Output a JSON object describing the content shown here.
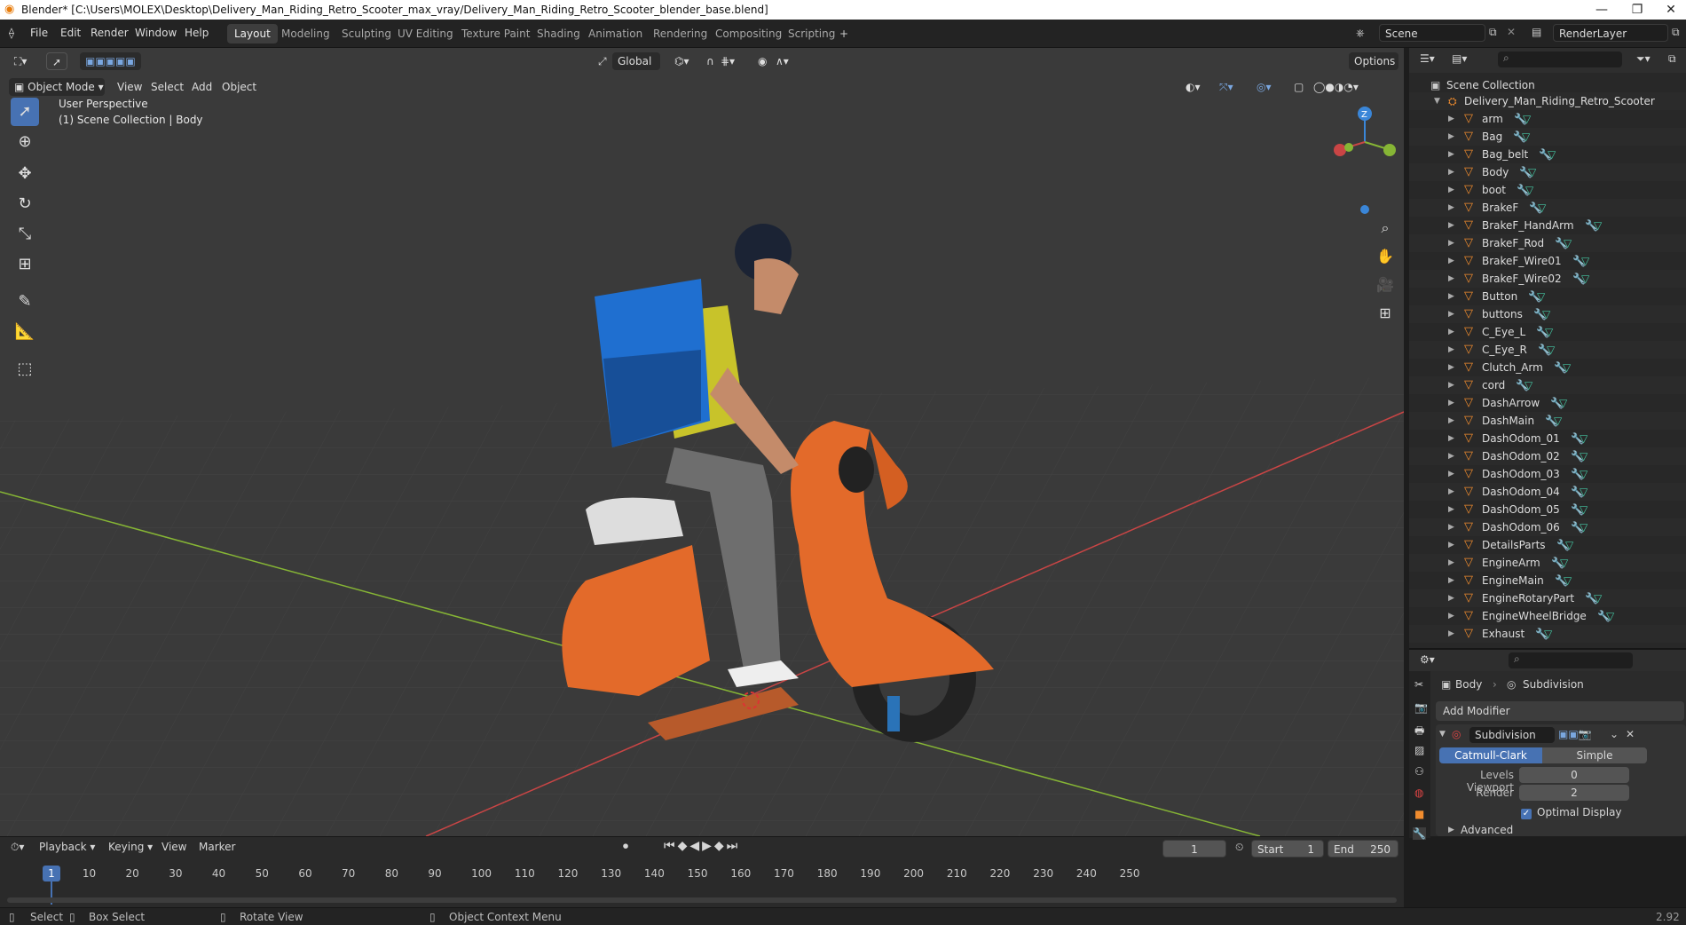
{
  "titlebar": {
    "title": "Blender* [C:\\Users\\MOLEX\\Desktop\\Delivery_Man_Riding_Retro_Scooter_max_vray/Delivery_Man_Riding_Retro_Scooter_blender_base.blend]",
    "minimize": "—",
    "maximize": "❐",
    "close": "✕"
  },
  "menu": {
    "items": [
      "File",
      "Edit",
      "Render",
      "Window",
      "Help"
    ],
    "workspaces": [
      "Layout",
      "Modeling",
      "Sculpting",
      "UV Editing",
      "Texture Paint",
      "Shading",
      "Animation",
      "Rendering",
      "Compositing",
      "Scripting"
    ],
    "active_workspace": "Layout",
    "add_tab": "+",
    "scene": "Scene",
    "render_layer": "RenderLayer"
  },
  "viewport_header": {
    "mode": "Object Mode",
    "menus": [
      "View",
      "Select",
      "Add",
      "Object"
    ],
    "orientation": "Global",
    "options": "Options"
  },
  "viewport": {
    "perspective": "User Perspective",
    "collection_info": "(1) Scene Collection | Body",
    "gizmo_z": "Z"
  },
  "outliner": {
    "root": "Scene Collection",
    "collection": "Delivery_Man_Riding_Retro_Scooter",
    "items": [
      "arm",
      "Bag",
      "Bag_belt",
      "Body",
      "boot",
      "BrakeF",
      "BrakeF_HandArm",
      "BrakeF_Rod",
      "BrakeF_Wire01",
      "BrakeF_Wire02",
      "Button",
      "buttons",
      "C_Eye_L",
      "C_Eye_R",
      "Clutch_Arm",
      "cord",
      "DashArrow",
      "DashMain",
      "DashOdom_01",
      "DashOdom_02",
      "DashOdom_03",
      "DashOdom_04",
      "DashOdom_05",
      "DashOdom_06",
      "DetailsParts",
      "EngineArm",
      "EngineMain",
      "EngineRotaryPart",
      "EngineWheelBridge",
      "Exhaust"
    ]
  },
  "properties": {
    "object": "Body",
    "modifier_tab": "Subdivision",
    "add_modifier": "Add Modifier",
    "modifier_name": "Subdivision",
    "type_catmull": "Catmull-Clark",
    "type_simple": "Simple",
    "levels_viewport_label": "Levels Viewport",
    "levels_viewport": "0",
    "render_label": "Render",
    "render": "2",
    "optimal_display": "Optimal Display",
    "advanced": "Advanced"
  },
  "timeline": {
    "menus": [
      "Playback",
      "Keying",
      "View",
      "Marker"
    ],
    "current_frame": "1",
    "start_label": "Start",
    "start": "1",
    "end_label": "End",
    "end": "250",
    "ticks": [
      "1",
      "10",
      "20",
      "30",
      "40",
      "50",
      "60",
      "70",
      "80",
      "90",
      "100",
      "110",
      "120",
      "130",
      "140",
      "150",
      "160",
      "170",
      "180",
      "190",
      "200",
      "210",
      "220",
      "230",
      "240",
      "250"
    ]
  },
  "statusbar": {
    "select": "Select",
    "box_select": "Box Select",
    "rotate_view": "Rotate View",
    "context_menu": "Object Context Menu",
    "version": "2.92"
  },
  "colors": {
    "accent": "#4772b3",
    "object_orange": "#f08c2e",
    "x_axis": "#c94545",
    "y_axis": "#86b535",
    "z_axis": "#3a86d8"
  }
}
